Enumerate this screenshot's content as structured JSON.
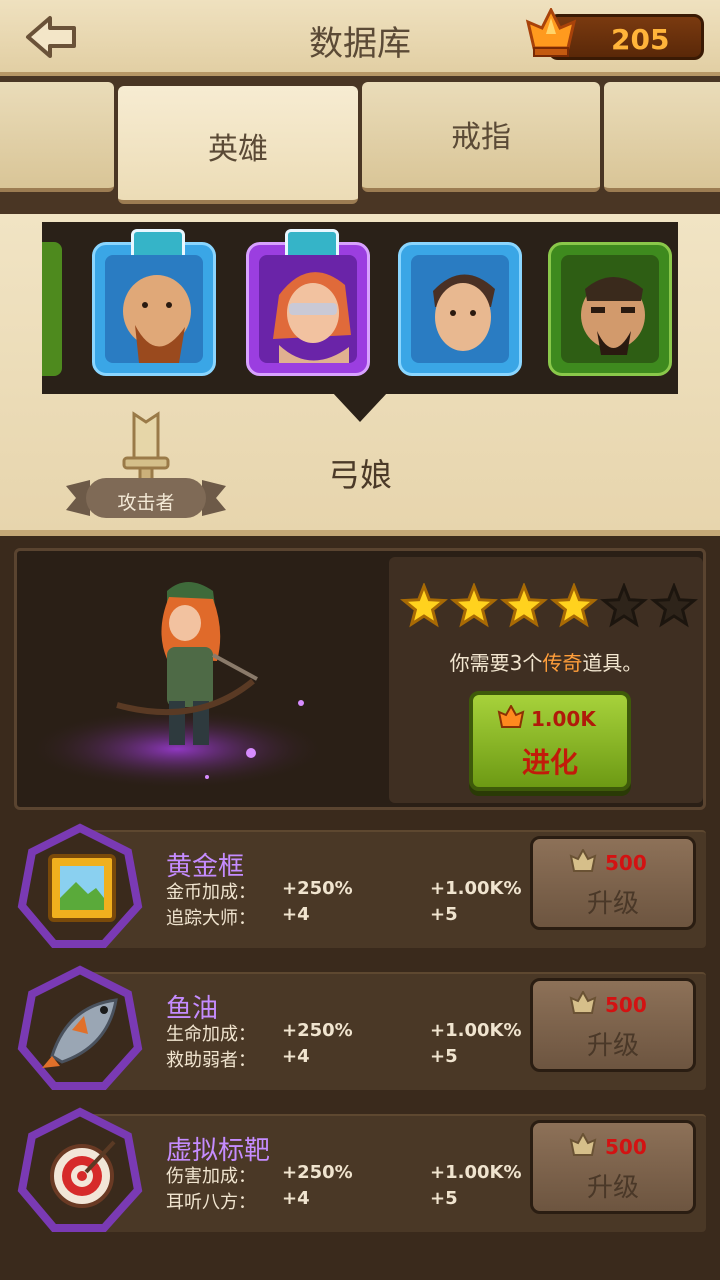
{
  "header": {
    "title": "数据库",
    "gem_count": "205",
    "back_icon": "back-arrow-icon",
    "gem_icon": "gem-icon"
  },
  "tabs": [
    {
      "label": ""
    },
    {
      "label": "英雄",
      "active": true
    },
    {
      "label": "戒指"
    },
    {
      "label": ""
    }
  ],
  "hero_select": {
    "portraits": [
      {
        "name": "bearded-brute",
        "frame_color": "#3aa6e6",
        "badge": true
      },
      {
        "name": "archer-girl",
        "frame_color": "#9b3ee0",
        "badge": true
      },
      {
        "name": "scrawny-man",
        "frame_color": "#3aa6e6",
        "badge": false
      },
      {
        "name": "barbarian",
        "frame_color": "#3e8a1e",
        "badge": false
      }
    ],
    "selected_name": "弓娘",
    "role_label": "攻击者",
    "role_icon": "sword-icon"
  },
  "evolve": {
    "stars_filled": 4,
    "stars_total": 6,
    "requirement_pre": "你需要3个",
    "requirement_highlight": "传奇",
    "requirement_post": "道具。",
    "cost": "1.00K",
    "button_label": "进化"
  },
  "items": [
    {
      "name": "黄金框",
      "icon": "picture-frame-icon",
      "stat1_label": "金币加成：",
      "stat1_value": "+250%",
      "stat1_next": "+1.00K%",
      "stat2_label": "追踪大师：",
      "stat2_value": "+4",
      "stat2_next": "+5",
      "cost": "500",
      "button_label": "升级"
    },
    {
      "name": "鱼油",
      "icon": "fish-icon",
      "stat1_label": "生命加成：",
      "stat1_value": "+250%",
      "stat1_next": "+1.00K%",
      "stat2_label": "救助弱者：",
      "stat2_value": "+4",
      "stat2_next": "+5",
      "cost": "500",
      "button_label": "升级"
    },
    {
      "name": "虚拟标靶",
      "icon": "target-icon",
      "stat1_label": "伤害加成：",
      "stat1_value": "+250%",
      "stat1_next": "+1.00K%",
      "stat2_label": "耳听八方：",
      "stat2_value": "+4",
      "stat2_next": "+5",
      "cost": "500",
      "button_label": "升级"
    }
  ],
  "colors": {
    "accent_purple": "#c58cff",
    "cost_red": "#d31212",
    "gem_orange": "#ffb43a"
  }
}
